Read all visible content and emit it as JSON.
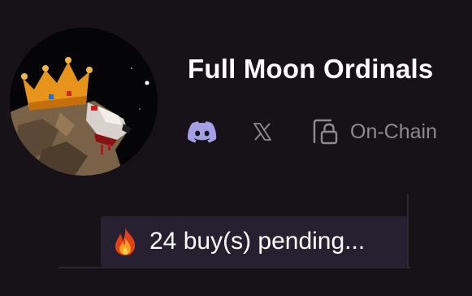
{
  "collection": {
    "name": "Full Moon Ordinals",
    "avatar_icon": "crowned-wolf-avatar"
  },
  "links": {
    "discord_icon": "discord-icon",
    "x_icon": "x-logo-icon",
    "onchain_icon": "lock-document-icon",
    "onchain_label": "On-Chain"
  },
  "pending": {
    "icon": "fire-icon",
    "text": "24 buy(s) pending..."
  },
  "colors": {
    "background": "#171217",
    "badge": "#262030",
    "muted": "#8c8a90",
    "discord": "#a59fe6"
  }
}
